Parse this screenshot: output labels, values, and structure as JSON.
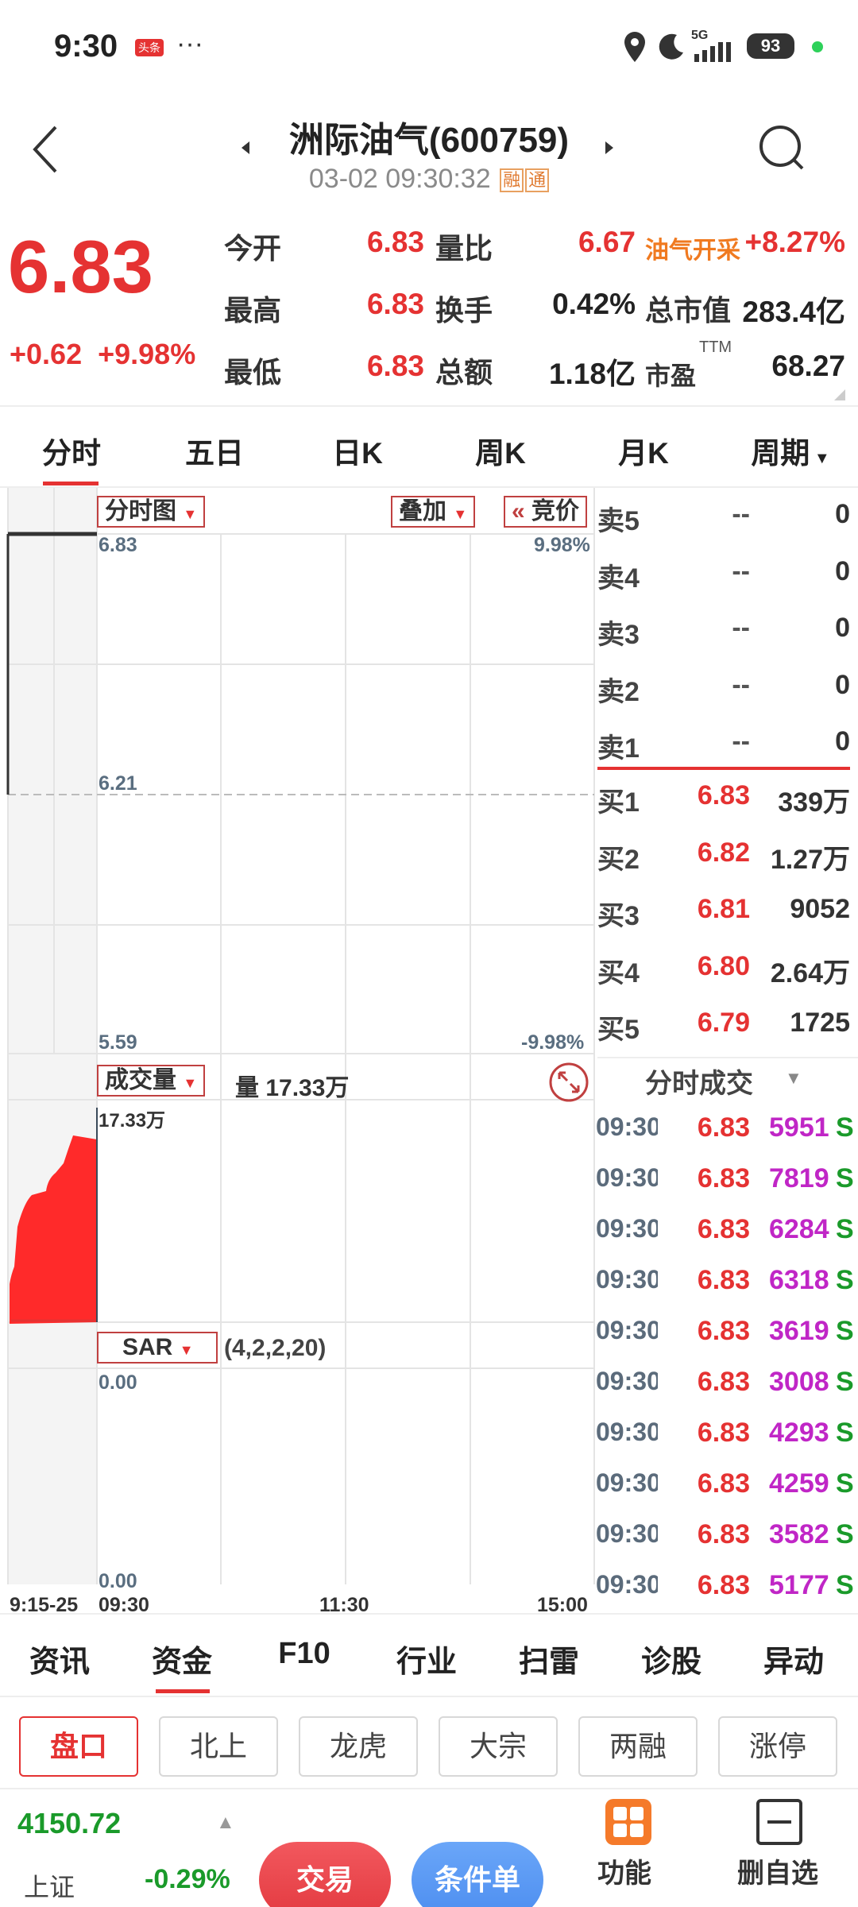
{
  "status": {
    "time": "9:30",
    "badge": "头条",
    "dots": "···",
    "net": "5G",
    "battery": "93"
  },
  "header": {
    "title": "洲际油气(600759)",
    "datetime": "03-02 09:30:32",
    "tag1": "融",
    "tag2": "通"
  },
  "quote": {
    "price": "6.83",
    "change": "+0.62",
    "change_pct": "+9.98%",
    "rows": [
      [
        {
          "label": "今开",
          "value": "6.83",
          "color": "red"
        },
        {
          "label": "量比",
          "value": "6.67",
          "color": "red"
        },
        {
          "label": "油气开采",
          "value": "+8.27%",
          "color": "red"
        }
      ],
      [
        {
          "label": "最高",
          "value": "6.83",
          "color": "red"
        },
        {
          "label": "换手",
          "value": "0.42%",
          "color": "dark"
        },
        {
          "label": "总市值",
          "value": "283.4亿",
          "color": "dark"
        }
      ],
      [
        {
          "label": "最低",
          "value": "6.83",
          "color": "red"
        },
        {
          "label": "总额",
          "value": "1.18亿",
          "color": "dark"
        },
        {
          "label": "市盈",
          "value": "68.27",
          "color": "dark",
          "sup": "TTM"
        }
      ]
    ]
  },
  "period_tabs": [
    "分时",
    "五日",
    "日K",
    "周K",
    "月K",
    "周期"
  ],
  "chart": {
    "main_dropdown": "分时图",
    "overlay_dropdown": "叠加",
    "auction_button": "竞价",
    "price_high": "6.83",
    "price_mid": "6.21",
    "price_low": "5.59",
    "pct_high": "9.98%",
    "pct_low": "-9.98%",
    "volume_dropdown": "成交量",
    "volume_label": "量 17.33万",
    "volume_max": "17.33万",
    "indicator_dropdown": "SAR",
    "indicator_params": "(4,2,2,20)",
    "ind_high": "0.00",
    "ind_low": "0.00",
    "x_labels": [
      "9:15-25",
      "09:30",
      "11:30",
      "15:00"
    ]
  },
  "order_book": {
    "sell": [
      {
        "label": "卖5",
        "price": "--",
        "vol": "0"
      },
      {
        "label": "卖4",
        "price": "--",
        "vol": "0"
      },
      {
        "label": "卖3",
        "price": "--",
        "vol": "0"
      },
      {
        "label": "卖2",
        "price": "--",
        "vol": "0"
      },
      {
        "label": "卖1",
        "price": "--",
        "vol": "0"
      }
    ],
    "buy": [
      {
        "label": "买1",
        "price": "6.83",
        "vol": "339万"
      },
      {
        "label": "买2",
        "price": "6.82",
        "vol": "1.27万"
      },
      {
        "label": "买3",
        "price": "6.81",
        "vol": "9052"
      },
      {
        "label": "买4",
        "price": "6.80",
        "vol": "2.64万"
      },
      {
        "label": "买5",
        "price": "6.79",
        "vol": "1725"
      }
    ]
  },
  "trades": {
    "title": "分时成交",
    "rows": [
      {
        "time": "09:30",
        "price": "6.83",
        "vol": "5951",
        "side": "S"
      },
      {
        "time": "09:30",
        "price": "6.83",
        "vol": "7819",
        "side": "S"
      },
      {
        "time": "09:30",
        "price": "6.83",
        "vol": "6284",
        "side": "S"
      },
      {
        "time": "09:30",
        "price": "6.83",
        "vol": "6318",
        "side": "S"
      },
      {
        "time": "09:30",
        "price": "6.83",
        "vol": "3619",
        "side": "S"
      },
      {
        "time": "09:30",
        "price": "6.83",
        "vol": "3008",
        "side": "S"
      },
      {
        "time": "09:30",
        "price": "6.83",
        "vol": "4293",
        "side": "S"
      },
      {
        "time": "09:30",
        "price": "6.83",
        "vol": "4259",
        "side": "S"
      },
      {
        "time": "09:30",
        "price": "6.83",
        "vol": "3582",
        "side": "S"
      },
      {
        "time": "09:30",
        "price": "6.83",
        "vol": "5177",
        "side": "S"
      }
    ]
  },
  "info_tabs": [
    "资讯",
    "资金",
    "F10",
    "行业",
    "扫雷",
    "诊股",
    "异动"
  ],
  "sub_tabs": [
    "盘口",
    "北上",
    "龙虎",
    "大宗",
    "两融",
    "涨停"
  ],
  "bottom": {
    "index_value": "4150.72",
    "index_name": "上证",
    "index_pct": "-0.29%",
    "trade": "交易",
    "condition": "条件单",
    "function": "功能",
    "remove": "删自选"
  },
  "colors": {
    "up": "#e53232",
    "down": "#1a9a2a",
    "accent": "#e53232",
    "volume": "#c026c6"
  }
}
